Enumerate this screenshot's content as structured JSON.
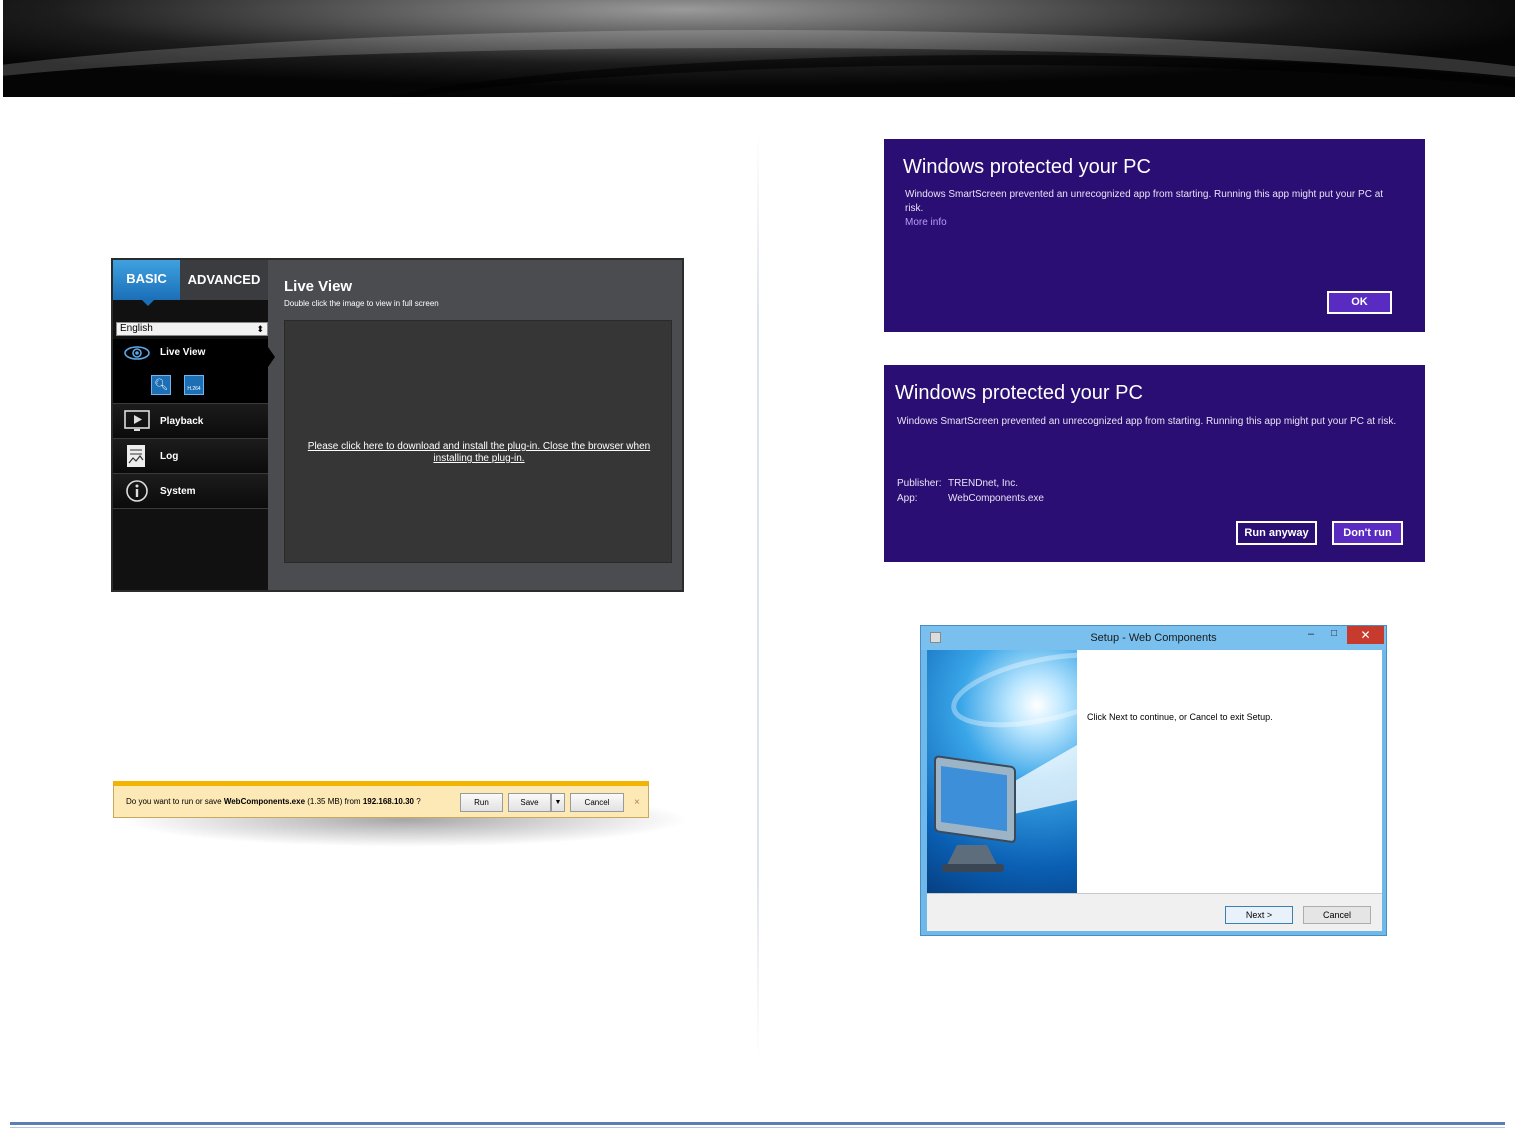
{
  "liveview": {
    "tab_basic": "BASIC",
    "tab_advanced": "ADVANCED",
    "language": "English",
    "menu": [
      {
        "label": "Live View"
      },
      {
        "label": "Playback"
      },
      {
        "label": "Log"
      },
      {
        "label": "System"
      }
    ],
    "sub_icons": [
      "zoom-icon",
      "h264-icon"
    ],
    "h264_label": "H.264",
    "title": "Live View",
    "subtitle": "Double click the image to view in full screen",
    "plugin_message": "Please click here to download and install the plug-in. Close the browser when installing the plug-in.",
    "accent": "#1b6fb8"
  },
  "download_bar": {
    "prefix": "Do you want to run or save ",
    "filename": "WebComponents.exe",
    "size": " (1.35 MB) from ",
    "host": "192.168.10.30",
    "suffix": " ?",
    "run": "Run",
    "save": "Save",
    "save_dropdown": "▼",
    "cancel": "Cancel",
    "close": "×"
  },
  "smartscreen1": {
    "title": "Windows protected your PC",
    "body": "Windows SmartScreen prevented an unrecognized app from starting. Running this app might put your PC at risk.",
    "more_info": "More info",
    "ok": "OK"
  },
  "smartscreen2": {
    "title": "Windows protected your PC",
    "body": "Windows SmartScreen prevented an unrecognized app from starting. Running this app might put your PC at risk.",
    "publisher_label": "Publisher:",
    "publisher_value": "TRENDnet, Inc.",
    "app_label": "App:",
    "app_value": "WebComponents.exe",
    "run_anyway": "Run anyway",
    "dont_run": "Don't run",
    "background": "#2b0e74"
  },
  "setup": {
    "title": "Setup - Web Components",
    "minimize": "–",
    "maximize": "□",
    "close": "✕",
    "message": "Click Next to continue, or Cancel to exit Setup.",
    "next": "Next >",
    "cancel": "Cancel"
  }
}
